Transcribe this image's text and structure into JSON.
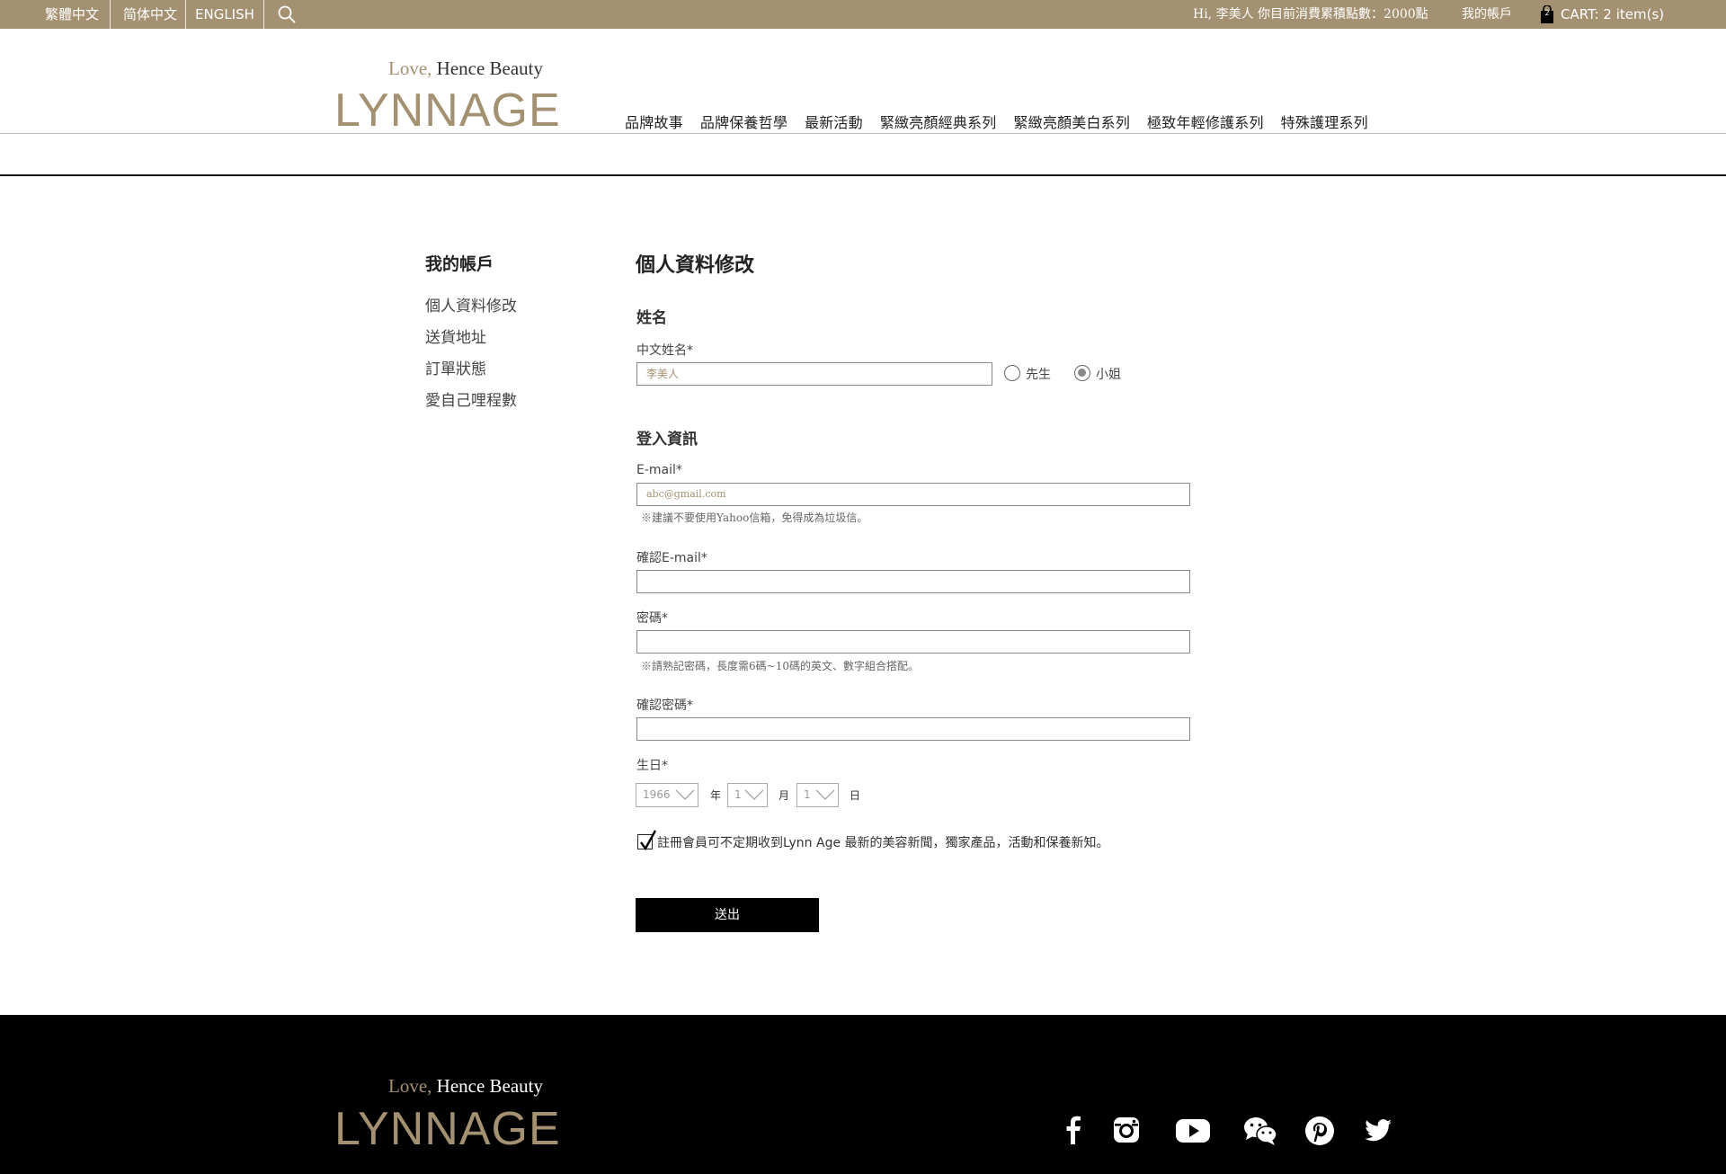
{
  "topbar": {
    "languages": [
      "繁體中文",
      "简体中文",
      "ENGLISH"
    ],
    "greeting": "Hi, 李美人 你目前消費累積點數：2000點",
    "account_link": "我的帳戶",
    "cart": "CART: 2 item(s)",
    "cart_count": "2",
    "search_icon": "search-icon",
    "colors": {
      "bar": "#a39171"
    }
  },
  "header": {
    "tagline_love": "Love,",
    "tagline_rest": " Hence Beauty",
    "logo_text": "LYNNAGE",
    "nav": [
      "品牌故事",
      "品牌保養哲學",
      "最新活動",
      "緊緻亮顏經典系列",
      "緊緻亮顏美白系列",
      "極致年輕修護系列",
      "特殊護理系列"
    ]
  },
  "sidebar": {
    "title": "我的帳戶",
    "items": [
      "個人資料修改",
      "送貨地址",
      "訂單狀態",
      "愛自己哩程數"
    ]
  },
  "form": {
    "title": "個人資料修改",
    "name_section": "姓名",
    "chinese_name_label": "中文姓名*",
    "chinese_name_value": "李美人",
    "gender_options": [
      "先生",
      "小姐"
    ],
    "gender_selected": "小姐",
    "login_section": "登入資訊",
    "email_label": "E-mail*",
    "email_value": "abc@gmail.com",
    "email_hint": "※建議不要使用Yahoo信箱，免得成為垃圾信。",
    "confirm_email_label": "確認E-mail*",
    "password_label": "密碼*",
    "password_hint": "※請熟記密碼，長度需6碼~10碼的英文、數字組合搭配。",
    "confirm_password_label": "確認密碼*",
    "birthday_label": "生日*",
    "birth_year": "1966",
    "year_unit": "年",
    "birth_month": "1",
    "month_unit": "月",
    "birth_day": "1",
    "day_unit": "日",
    "newsletter_checked": true,
    "newsletter_text": "註冊會員可不定期收到Lynn Age 最新的美容新聞，獨家產品，活動和保養新知。",
    "submit_label": "送出"
  },
  "footer": {
    "tagline_love": "Love,",
    "tagline_rest": " Hence Beauty",
    "logo_text": "LYNNAGE",
    "social_icons": [
      "facebook-icon",
      "instagram-icon",
      "youtube-icon",
      "wechat-icon",
      "pinterest-icon",
      "twitter-icon"
    ]
  },
  "colors": {
    "accent": "#a39171",
    "footer_bg": "#000000",
    "button_bg": "#000000"
  }
}
